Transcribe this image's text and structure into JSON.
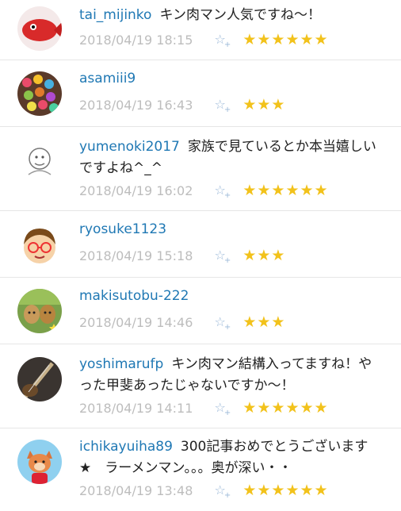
{
  "comments": [
    {
      "user": "tai_mijinko",
      "text": "キン肉マン人気ですね〜！",
      "date": "2018/04/19 18:15",
      "stars": "★★★★★★",
      "avatar": "red-fish-avatar"
    },
    {
      "user": "asamiii9",
      "text": "",
      "date": "2018/04/19 16:43",
      "stars": "★★★",
      "avatar": "colorful-beads-avatar"
    },
    {
      "user": "yumenoki2017",
      "text": "家族で見ているとか本当嬉しいですよね^_^",
      "date": "2018/04/19 16:02",
      "stars": "★★★★★★",
      "avatar": "sketch-sheep-avatar"
    },
    {
      "user": "ryosuke1123",
      "text": "",
      "date": "2018/04/19 15:18",
      "stars": "★★★",
      "avatar": "glasses-boy-avatar"
    },
    {
      "user": "makisutobu-222",
      "text": "",
      "date": "2018/04/19 14:46",
      "stars": "★★★",
      "avatar": "dogs-avatar"
    },
    {
      "user": "yoshimarufp",
      "text": "キン肉マン結構入ってますね！やった甲斐あったじゃないですか〜！",
      "date": "2018/04/19 14:11",
      "stars": "★★★★★★",
      "avatar": "guitar-avatar"
    },
    {
      "user": "ichikayuiha89",
      "text": "300記事おめでとうございます★　ラーメンマン。。。奥が深い・・",
      "date": "2018/04/19 13:48",
      "stars": "★★★★★★",
      "avatar": "fox-mascot-avatar"
    }
  ],
  "add_star_icon": "☆",
  "add_star_plus": "+",
  "colors": {
    "username": "#1f78b4",
    "star": "#f2c21b",
    "meta": "#bdbdbd"
  }
}
